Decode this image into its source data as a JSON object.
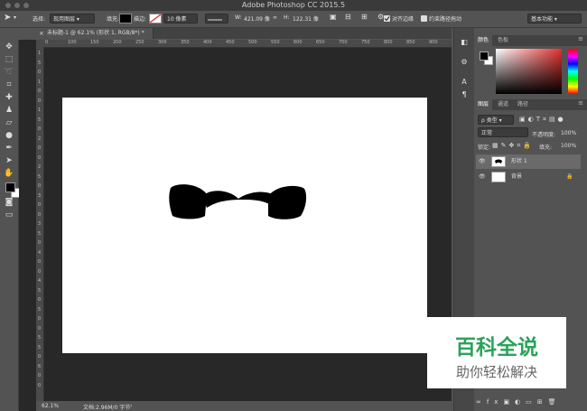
{
  "app": {
    "title": "Adobe Photoshop CC 2015.5"
  },
  "options": {
    "select_label": "选择:",
    "select_value": "现用图层",
    "fill_label": "填充:",
    "stroke_label": "描边:",
    "stroke_width": "10 像素",
    "w_label": "W:",
    "w_value": "421.09 像",
    "h_label": "H:",
    "h_value": "122.31 像",
    "align_edges": "对齐边缘",
    "constrain_path": "约束路径拖动",
    "workspace": "基本功能"
  },
  "document": {
    "tab_label": "未标题-1 @ 62.1% (形状 1, RGB/8*) *",
    "zoom": "62.1%",
    "doc_info": "文档:2.96M/0 字节"
  },
  "rulers": {
    "top": [
      "0",
      "100",
      "150",
      "200",
      "250",
      "300",
      "350",
      "400",
      "450",
      "500",
      "550",
      "600",
      "650",
      "700",
      "750",
      "800",
      "850",
      "900"
    ],
    "left": [
      "1",
      "5",
      "0",
      "1",
      "0",
      "0",
      "1",
      "5",
      "0",
      "2",
      "0",
      "0",
      "2",
      "5",
      "0",
      "3",
      "0",
      "0",
      "3",
      "5",
      "0",
      "4",
      "0",
      "0",
      "4",
      "5",
      "0",
      "5",
      "0",
      "0",
      "5",
      "5",
      "0",
      "6",
      "0",
      "0"
    ]
  },
  "color_panel": {
    "tabs": [
      "颜色",
      "色板"
    ]
  },
  "layers_panel": {
    "tabs": [
      "图层",
      "通道",
      "路径"
    ],
    "filter_value": "ρ 类型",
    "blend_mode": "正常",
    "opacity_label": "不透明度:",
    "opacity_value": "100%",
    "lock_label": "锁定:",
    "fill_label": "填充:",
    "fill_value": "100%",
    "layers": [
      {
        "name": "形状 1"
      },
      {
        "name": "背景"
      }
    ]
  },
  "watermark": {
    "line1": "百科全说",
    "line2": "助你轻松解决"
  },
  "colors": {
    "shape_fill": "#000000",
    "foreground": "#000000",
    "background": "#ffffff"
  }
}
